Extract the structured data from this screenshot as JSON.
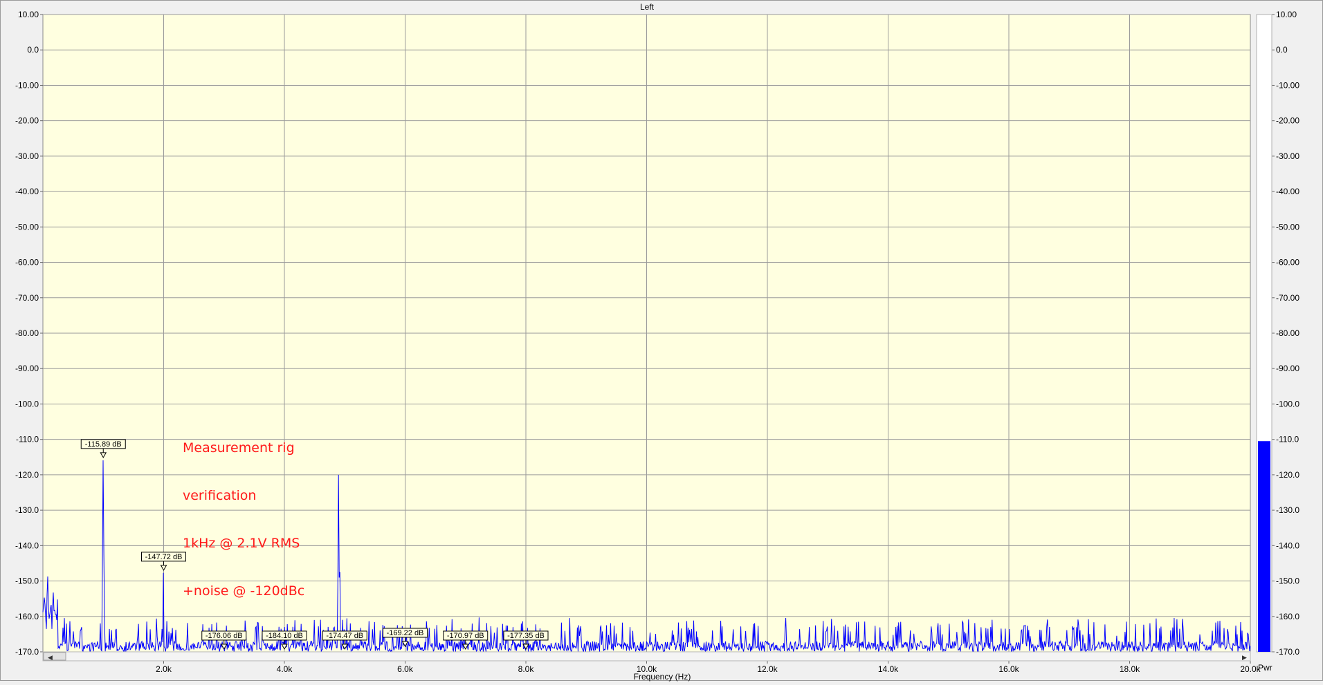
{
  "window": {
    "title": "Left"
  },
  "annotation": {
    "lines": [
      "Measurement rig",
      "verification",
      "1kHz @ 2.1V RMS",
      "+noise @ -120dBc"
    ]
  },
  "meter": {
    "label": "Pwr",
    "level_db": -110.5,
    "color": "#0000ff"
  },
  "colors": {
    "plot_bg": "#ffffe0",
    "trace": "#0000ff",
    "grid": "#9a9a9a",
    "annotation": "#ff0000"
  },
  "chart_data": {
    "type": "line",
    "title": "Left",
    "xlabel": "Frequency (Hz)",
    "ylabel": "",
    "xlim": [
      0,
      20000
    ],
    "ylim": [
      -170,
      10
    ],
    "grid": true,
    "x_ticks": [
      {
        "value": 2000,
        "label": "2.0k"
      },
      {
        "value": 4000,
        "label": "4.0k"
      },
      {
        "value": 6000,
        "label": "6.0k"
      },
      {
        "value": 8000,
        "label": "8.0k"
      },
      {
        "value": 10000,
        "label": "10.0k"
      },
      {
        "value": 12000,
        "label": "12.0k"
      },
      {
        "value": 14000,
        "label": "14.0k"
      },
      {
        "value": 16000,
        "label": "16.0k"
      },
      {
        "value": 18000,
        "label": "18.0k"
      },
      {
        "value": 20000,
        "label": "20.0k"
      }
    ],
    "y_ticks": [
      {
        "value": 10,
        "label": "10.00"
      },
      {
        "value": 0,
        "label": "0.0"
      },
      {
        "value": -10,
        "label": "-10.00"
      },
      {
        "value": -20,
        "label": "-20.00"
      },
      {
        "value": -30,
        "label": "-30.00"
      },
      {
        "value": -40,
        "label": "-40.00"
      },
      {
        "value": -50,
        "label": "-50.00"
      },
      {
        "value": -60,
        "label": "-60.00"
      },
      {
        "value": -70,
        "label": "-70.00"
      },
      {
        "value": -80,
        "label": "-80.00"
      },
      {
        "value": -90,
        "label": "-90.00"
      },
      {
        "value": -100,
        "label": "-100.0"
      },
      {
        "value": -110,
        "label": "-110.0"
      },
      {
        "value": -120,
        "label": "-120.0"
      },
      {
        "value": -130,
        "label": "-130.0"
      },
      {
        "value": -140,
        "label": "-140.0"
      },
      {
        "value": -150,
        "label": "-150.0"
      },
      {
        "value": -160,
        "label": "-160.0"
      },
      {
        "value": -170,
        "label": "-170.0"
      }
    ],
    "series": [
      {
        "name": "Left",
        "peaks": [
          {
            "x": 1000,
            "y": -115.9
          },
          {
            "x": 2000,
            "y": -147.7
          },
          {
            "x": 4900,
            "y": -120.0
          }
        ],
        "noise_floor": -167
      }
    ],
    "markers": [
      {
        "x": 1000,
        "y": -115.89,
        "label": "-115.89 dB"
      },
      {
        "x": 2000,
        "y": -147.72,
        "label": "-147.72 dB"
      },
      {
        "x": 3000,
        "y": -176.06,
        "label": "-176.06 dB"
      },
      {
        "x": 4000,
        "y": -184.1,
        "label": "-184.10 dB"
      },
      {
        "x": 5000,
        "y": -174.47,
        "label": "-174.47 dB"
      },
      {
        "x": 6000,
        "y": -169.22,
        "label": "-169.22 dB"
      },
      {
        "x": 7000,
        "y": -170.97,
        "label": "-170.97 dB"
      },
      {
        "x": 8000,
        "y": -177.35,
        "label": "-177.35 dB"
      }
    ]
  }
}
